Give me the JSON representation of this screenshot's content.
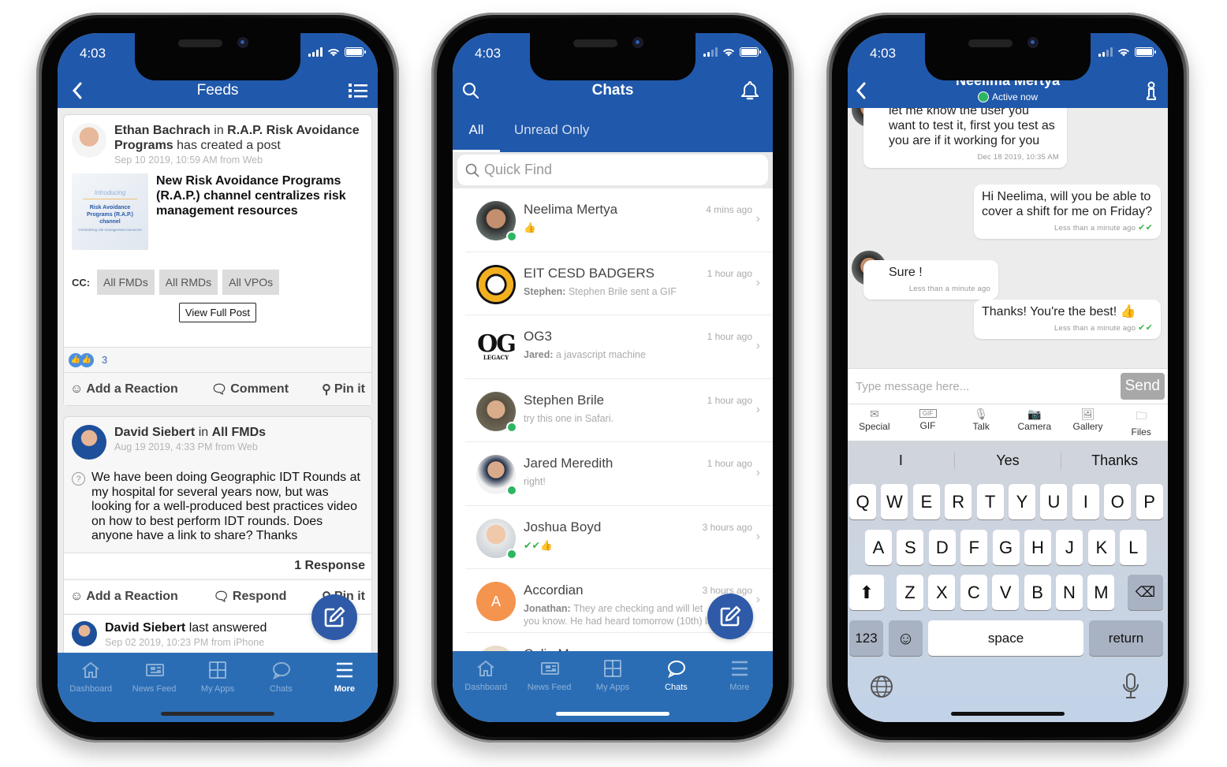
{
  "status": {
    "time": "4:03"
  },
  "feeds": {
    "title": "Feeds",
    "post1": {
      "author": "Ethan Bachrach",
      "in_word": "in",
      "channel": "R.A.P. Risk Avoidance Programs",
      "action": "has created a post",
      "meta": "Sep 10 2019, 10:59 AM from Web",
      "thumb_intro": "Introducing",
      "thumb_title": "Risk Avoidance Programs (R.A.P.) channel",
      "thumb_sub": "Centralizing risk management resources",
      "headline": "New Risk Avoidance Programs (R.A.P.) channel centralizes risk management resources",
      "cc_label": "CC:",
      "cc": [
        "All FMDs",
        "All RMDs",
        "All VPOs"
      ],
      "view_full": "View Full Post",
      "reaction_count": "3",
      "actions": {
        "reaction": "Add a Reaction",
        "comment": "Comment",
        "pin": "Pin it"
      }
    },
    "post2": {
      "author": "David Siebert",
      "in_word": "in",
      "channel": "All FMDs",
      "meta": "Aug 19 2019, 4:33 PM from Web",
      "body": "We have been doing Geographic IDT Rounds at my hospital for several years now, but was looking for a well-produced best practices video on how to best perform IDT rounds. Does anyone have a link to share? Thanks",
      "responses": "1 Response",
      "actions": {
        "reaction": "Add a Reaction",
        "respond": "Respond",
        "pin": "Pin it"
      },
      "last_author": "David Siebert",
      "last_text": "last answered",
      "last_meta": "Sep 02 2019, 10:23 PM from iPhone"
    }
  },
  "tabbar": {
    "dashboard": "Dashboard",
    "news_feed": "News Feed",
    "my_apps": "My Apps",
    "chats": "Chats",
    "more": "More"
  },
  "chats": {
    "title": "Chats",
    "tabs": {
      "all": "All",
      "unread": "Unread Only"
    },
    "search_placeholder": "Quick Find",
    "rows": [
      {
        "name": "Neelima Mertya",
        "sender": "",
        "preview": "👍",
        "ago": "4 mins ago",
        "online": true
      },
      {
        "name": "EIT CESD BADGERS",
        "sender": "Stephen:",
        "preview": "Stephen Brile sent a GIF",
        "ago": "1 hour ago",
        "online": false
      },
      {
        "name": "OG3",
        "sender": "Jared:",
        "preview": "a javascript machine",
        "ago": "1 hour ago",
        "online": false
      },
      {
        "name": "Stephen Brile",
        "sender": "",
        "preview": "try this one in Safari.",
        "ago": "1 hour ago",
        "online": true
      },
      {
        "name": "Jared Meredith",
        "sender": "",
        "preview": "right!",
        "ago": "1 hour ago",
        "online": true
      },
      {
        "name": "Joshua Boyd",
        "sender": "",
        "preview": "✔✔👍",
        "ago": "3 hours ago",
        "online": true
      },
      {
        "name": "Accordian",
        "sender": "Jonathan:",
        "preview": "They are checking and will let you know. He had heard tomorrow (10th) la",
        "ago": "3 hours ago",
        "online": false,
        "initial": "A"
      },
      {
        "name": "Colin M",
        "sender": "",
        "preview": "",
        "ago": "",
        "online": false
      }
    ],
    "og_logo": "OG",
    "og_sub": "LEGACY"
  },
  "convo": {
    "name": "Neelima Mertya",
    "presence": "Active now",
    "messages": [
      {
        "from": "them",
        "text": "let me know the user you want to test it, first you test as you are if it working for you",
        "time": "Dec 18 2019, 10:35 AM"
      },
      {
        "from": "me",
        "text": "Hi Neelima, will you be able to cover a shift for me on Friday?",
        "time": "Less than a minute ago"
      },
      {
        "from": "them",
        "text": "Sure !",
        "time": "Less than a minute ago"
      },
      {
        "from": "me",
        "text": "Thanks! You're the best! 👍",
        "time": "Less than a minute ago"
      }
    ],
    "input_placeholder": "Type message here...",
    "send": "Send",
    "attach": [
      "Special",
      "GIF",
      "Talk",
      "Camera",
      "Gallery",
      "Files"
    ],
    "suggestions": [
      "I",
      "Yes",
      "Thanks"
    ],
    "keys_row1": [
      "Q",
      "W",
      "E",
      "R",
      "T",
      "Y",
      "U",
      "I",
      "O",
      "P"
    ],
    "keys_row2": [
      "A",
      "S",
      "D",
      "F",
      "G",
      "H",
      "J",
      "K",
      "L"
    ],
    "keys_row3": [
      "Z",
      "X",
      "C",
      "V",
      "B",
      "N",
      "M"
    ],
    "key_123": "123",
    "key_space": "space",
    "key_return": "return"
  },
  "colors": {
    "brand": "#2058ab",
    "tabbar": "#2b6db5",
    "online": "#2db563",
    "fab": "#2f5aa8",
    "accordian": "#f5944f"
  }
}
